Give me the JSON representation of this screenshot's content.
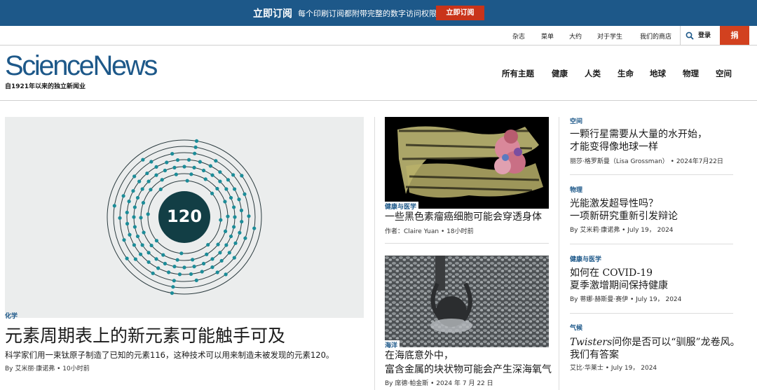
{
  "promo": {
    "title": "立即订阅",
    "text": "每个印刷订阅都附带完整的数字访问权限",
    "button": "立即订阅"
  },
  "utility": {
    "links": [
      "杂志",
      "菜单",
      "大约",
      "对于学生",
      "我们的商店"
    ],
    "login": "登录",
    "donate": "捐"
  },
  "header": {
    "logo": "ScienceNews",
    "tagline": "自1921年以来的独立新闻业",
    "nav": [
      "所有主题",
      "健康",
      "人类",
      "生命",
      "地球",
      "物理",
      "空间"
    ]
  },
  "feature": {
    "image_number": "120",
    "category": "化学",
    "title": "元素周期表上的新元素可能触手可及",
    "description": "科学家们用一束钛原子制造了已知的元素116，这种技术可以用来制造未被发现的元素120。",
    "byline": "By 艾米丽·康诺弗 • 10小时前"
  },
  "middle": [
    {
      "category": "健康与医学",
      "title": "一些黑色素瘤癌细胞可能会穿透身体",
      "byline": "作者：Claire Yuan • 18小时前"
    },
    {
      "category": "海洋",
      "title_line1": "在海底意外中，",
      "title_line2": "富含金属的块状物可能会产生深海氧气",
      "byline": "By 席德·帕金斯 • 2024 年 7 月 22 日"
    }
  ],
  "right": [
    {
      "category": "空间",
      "title_line1": "一颗行星需要从大量的水开始，",
      "title_line2": "才能变得像地球一样",
      "byline": "丽莎·格罗斯曼（Lisa Grossman） • 2024年7月22日"
    },
    {
      "category": "物理",
      "title_line1": "光能激发超导性吗？",
      "title_line2": "一项新研究重新引发辩论",
      "byline": "By 艾米莉·康诺弗 • July 19， 2024"
    },
    {
      "category": "健康与医学",
      "title_line1": "如何在 COVID-19",
      "title_line2": "夏季激增期间保持健康",
      "byline": "By 蒂娜·赫斯曼·赛伊 • July 19， 2024"
    },
    {
      "category": "气候",
      "title_italic": "Twisters",
      "title_rest": "问你是否可以“驯服”龙卷风。",
      "title_line2": "我们有答案",
      "byline": "艾比·华莱士 • July 19， 2024"
    }
  ],
  "colors": {
    "brand_blue": "#1d5889",
    "accent_red": "#c9341a",
    "atom_teal": "#1c8c98",
    "atom_core": "#123e45"
  }
}
